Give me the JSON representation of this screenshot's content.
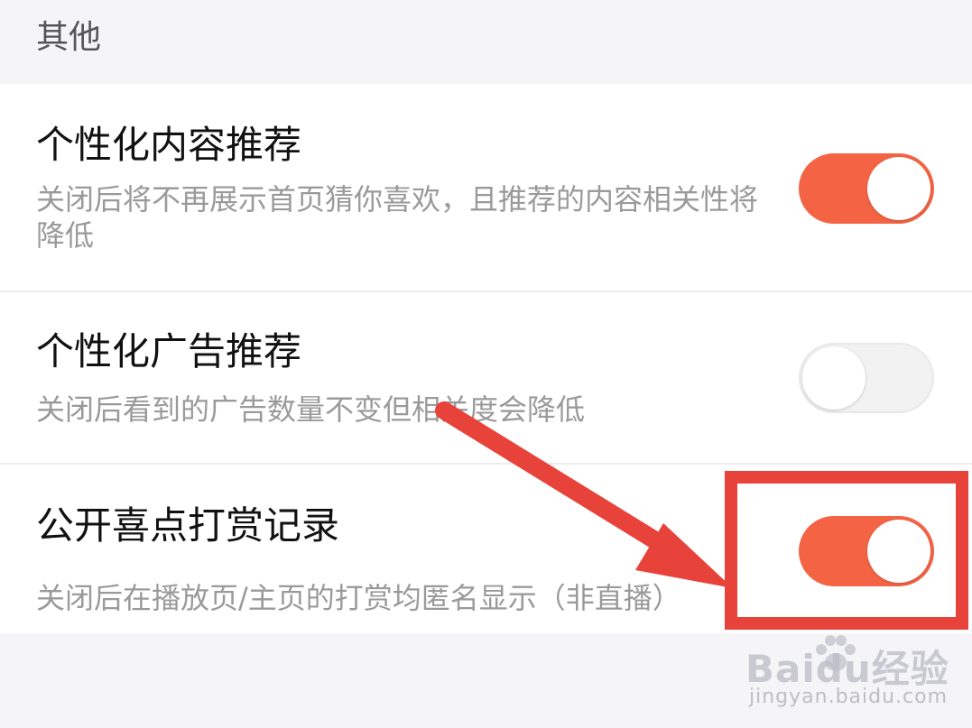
{
  "section": {
    "title": "其他"
  },
  "rows": [
    {
      "title": "个性化内容推荐",
      "description": "关闭后将不再展示首页猜你喜欢，且推荐的内容相关性将降低",
      "toggle_on": true
    },
    {
      "title": "个性化广告推荐",
      "description": "关闭后看到的广告数量不变但相关度会降低",
      "toggle_on": false
    },
    {
      "title": "公开喜点打赏记录",
      "description": "关闭后在播放页/主页的打赏均匿名显示（非直播）",
      "toggle_on": true
    }
  ],
  "colors": {
    "toggle_on": "#f46444",
    "toggle_off": "#f2f2f2",
    "annotation": "#e8433a"
  },
  "icons": {
    "annotation_arrow": "arrow-icon",
    "watermark_paw": "paw-icon"
  },
  "watermark": {
    "logo": "Baidu经验",
    "url": "jingyan.baidu.com"
  }
}
